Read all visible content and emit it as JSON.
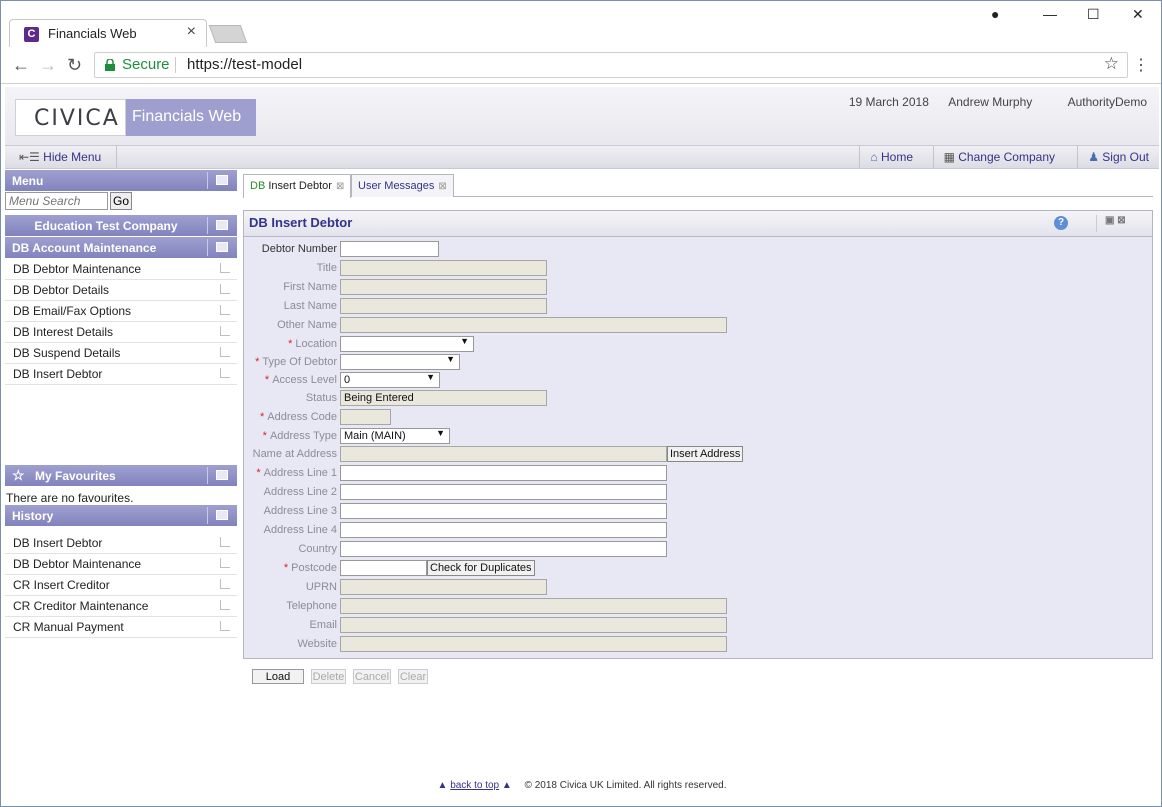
{
  "browser": {
    "tab_title": "Financials Web",
    "secure_label": "Secure",
    "url": "https://test-model"
  },
  "app": {
    "logo_text": "CIVICA",
    "product_name": "Financials Web",
    "date": "19 March 2018",
    "user": "Andrew Murphy",
    "authority": "AuthorityDemo",
    "hide_menu": "Hide Menu",
    "home": "Home",
    "change_company": "Change Company",
    "sign_out": "Sign Out"
  },
  "menu": {
    "title": "Menu",
    "search_placeholder": "Menu Search",
    "go": "Go",
    "company": "Education Test Company",
    "section": "DB Account Maintenance",
    "items": [
      {
        "label": "DB Debtor Maintenance"
      },
      {
        "label": "DB Debtor Details"
      },
      {
        "label": "DB Email/Fax Options"
      },
      {
        "label": "DB Interest Details"
      },
      {
        "label": "DB Suspend Details"
      },
      {
        "label": "DB Insert Debtor"
      }
    ]
  },
  "favourites": {
    "title": "My Favourites",
    "empty": "There are no favourites."
  },
  "history": {
    "title": "History",
    "items": [
      {
        "label": "DB Insert Debtor"
      },
      {
        "label": "DB Debtor Maintenance"
      },
      {
        "label": "CR Insert Creditor"
      },
      {
        "label": "CR Creditor Maintenance"
      },
      {
        "label": "CR Manual Payment"
      }
    ]
  },
  "tabs": {
    "active_prefix": "DB",
    "active": "Insert Debtor",
    "second": "User Messages"
  },
  "form": {
    "title": "DB Insert Debtor",
    "fields": {
      "debtor_number": {
        "label": "Debtor Number",
        "value": ""
      },
      "title": {
        "label": "Title",
        "value": ""
      },
      "first_name": {
        "label": "First Name",
        "value": ""
      },
      "last_name": {
        "label": "Last Name",
        "value": ""
      },
      "other_name": {
        "label": "Other Name",
        "value": ""
      },
      "location": {
        "label": "Location",
        "value": ""
      },
      "type_of_debtor": {
        "label": "Type Of Debtor",
        "value": ""
      },
      "access_level": {
        "label": "Access Level",
        "value": "0"
      },
      "status": {
        "label": "Status",
        "value": "Being Entered"
      },
      "address_code": {
        "label": "Address Code",
        "value": ""
      },
      "address_type": {
        "label": "Address Type",
        "value": "Main (MAIN)"
      },
      "name_at_address": {
        "label": "Name at Address",
        "value": ""
      },
      "address_line_1": {
        "label": "Address Line 1",
        "value": ""
      },
      "address_line_2": {
        "label": "Address Line 2",
        "value": ""
      },
      "address_line_3": {
        "label": "Address Line 3",
        "value": ""
      },
      "address_line_4": {
        "label": "Address Line 4",
        "value": ""
      },
      "country": {
        "label": "Country",
        "value": ""
      },
      "postcode": {
        "label": "Postcode",
        "value": ""
      },
      "uprn": {
        "label": "UPRN",
        "value": ""
      },
      "telephone": {
        "label": "Telephone",
        "value": ""
      },
      "email": {
        "label": "Email",
        "value": ""
      },
      "website": {
        "label": "Website",
        "value": ""
      }
    },
    "insert_address": "Insert Address",
    "check_duplicates": "Check for Duplicates"
  },
  "actions": {
    "load": "Load",
    "delete": "Delete",
    "cancel": "Cancel",
    "clear": "Clear"
  },
  "footer": {
    "back_to_top": "back to top",
    "copyright": "© 2018 Civica UK Limited. All rights reserved."
  }
}
